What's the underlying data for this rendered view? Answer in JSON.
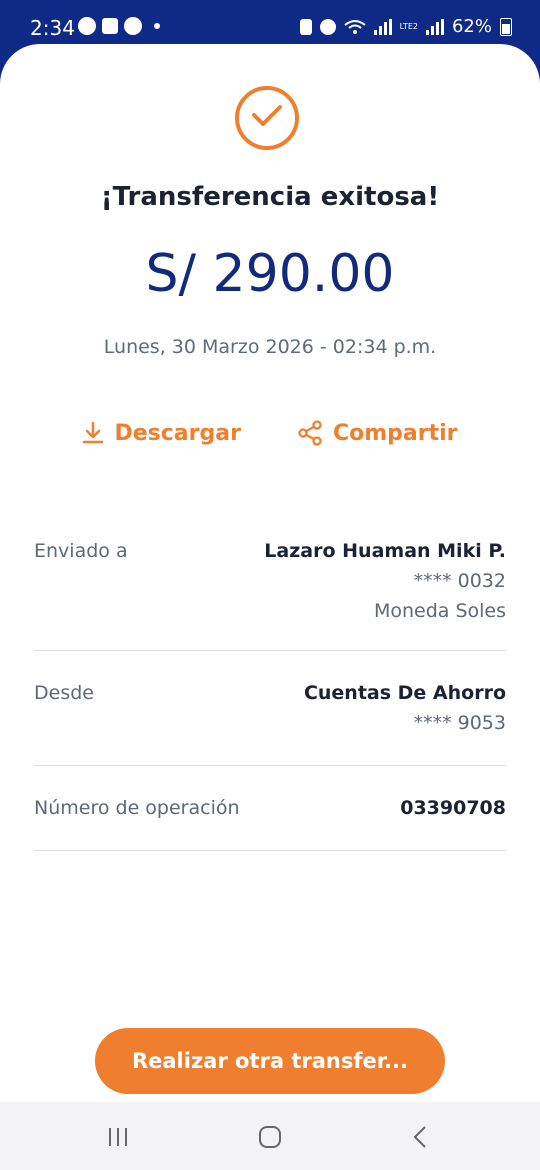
{
  "status": {
    "time": "2:34",
    "battery": "62%",
    "lte_label": "LTE2"
  },
  "receipt": {
    "title": "¡Transferencia exitosa!",
    "amount": "S/ 290.00",
    "datetime": "Lunes, 30 Marzo 2026 - 02:34 p.m."
  },
  "actions": {
    "download_label": "Descargar",
    "share_label": "Compartir"
  },
  "details": [
    {
      "label": "Enviado a",
      "value": "Lazaro Huaman Miki P.",
      "line2": "**** 0032",
      "line3": "Moneda Soles"
    },
    {
      "label": "Desde",
      "value": "Cuentas De Ahorro",
      "line2": "**** 9053"
    },
    {
      "label": "Número de operación",
      "value": "03390708"
    }
  ],
  "cta": {
    "label": "Realizar otra transfer..."
  },
  "colors": {
    "accent": "#ef7f2e",
    "brand": "#0f2a86",
    "amount": "#122a7e"
  },
  "icons": [
    "whatsapp-icon",
    "notification-icon",
    "messenger-icon",
    "alarm-icon",
    "wifi-icon",
    "signal-icon",
    "battery-icon",
    "check-icon",
    "download-icon",
    "share-icon",
    "recent-apps-icon",
    "home-icon",
    "back-icon"
  ]
}
